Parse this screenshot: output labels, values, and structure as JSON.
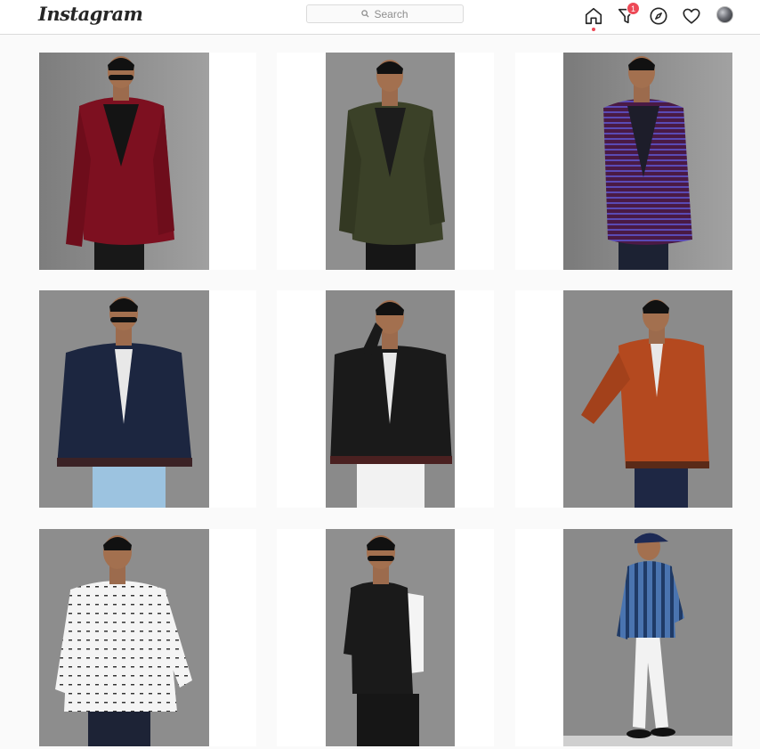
{
  "app": {
    "brand": "Instagram"
  },
  "search": {
    "placeholder": "Search"
  },
  "nav": {
    "items": [
      {
        "icon": "home-icon",
        "active": true
      },
      {
        "icon": "direct-filter-icon",
        "badge": "1"
      },
      {
        "icon": "explore-compass-icon"
      },
      {
        "icon": "activity-heart-icon"
      },
      {
        "icon": "profile-avatar"
      }
    ]
  },
  "colors": {
    "accent": "#ed4956",
    "border": "#dbdbdb",
    "backdrop": "#8a8a8a"
  },
  "posts": [
    {
      "subject": "red velvet blazer",
      "jacket": "#7d1020",
      "inner": "#141414",
      "pants": "#181818"
    },
    {
      "subject": "olive green blazer",
      "jacket": "#3b4128",
      "inner": "#1c1c1c",
      "pants": "#161616"
    },
    {
      "subject": "purple striped blazer",
      "jacket": "#4a1a45",
      "inner": "#1d1d2a",
      "pants": "#1c2233"
    },
    {
      "subject": "navy bomber jacket",
      "jacket": "#1c2640",
      "inner": "#e8e8e8",
      "pants": "#9cc3e0"
    },
    {
      "subject": "black bomber jacket",
      "jacket": "#1a1a1a",
      "inner": "#e8e8e8",
      "pants": "#f2f2f2"
    },
    {
      "subject": "rust orange jacket",
      "jacket": "#b4491f",
      "inner": "#e8e8e8",
      "pants": "#1e2744"
    },
    {
      "subject": "white printed shirt",
      "jacket": "#f4f4f4",
      "inner": "#f4f4f4",
      "pants": "#1d2336"
    },
    {
      "subject": "black nehru vest",
      "jacket": "#1a1a1a",
      "inner": "#f4f4f4",
      "pants": "#161616"
    },
    {
      "subject": "blue striped hoodie",
      "jacket": "#4a74b0",
      "inner": "#4a74b0",
      "pants": "#f2f2f2"
    }
  ]
}
